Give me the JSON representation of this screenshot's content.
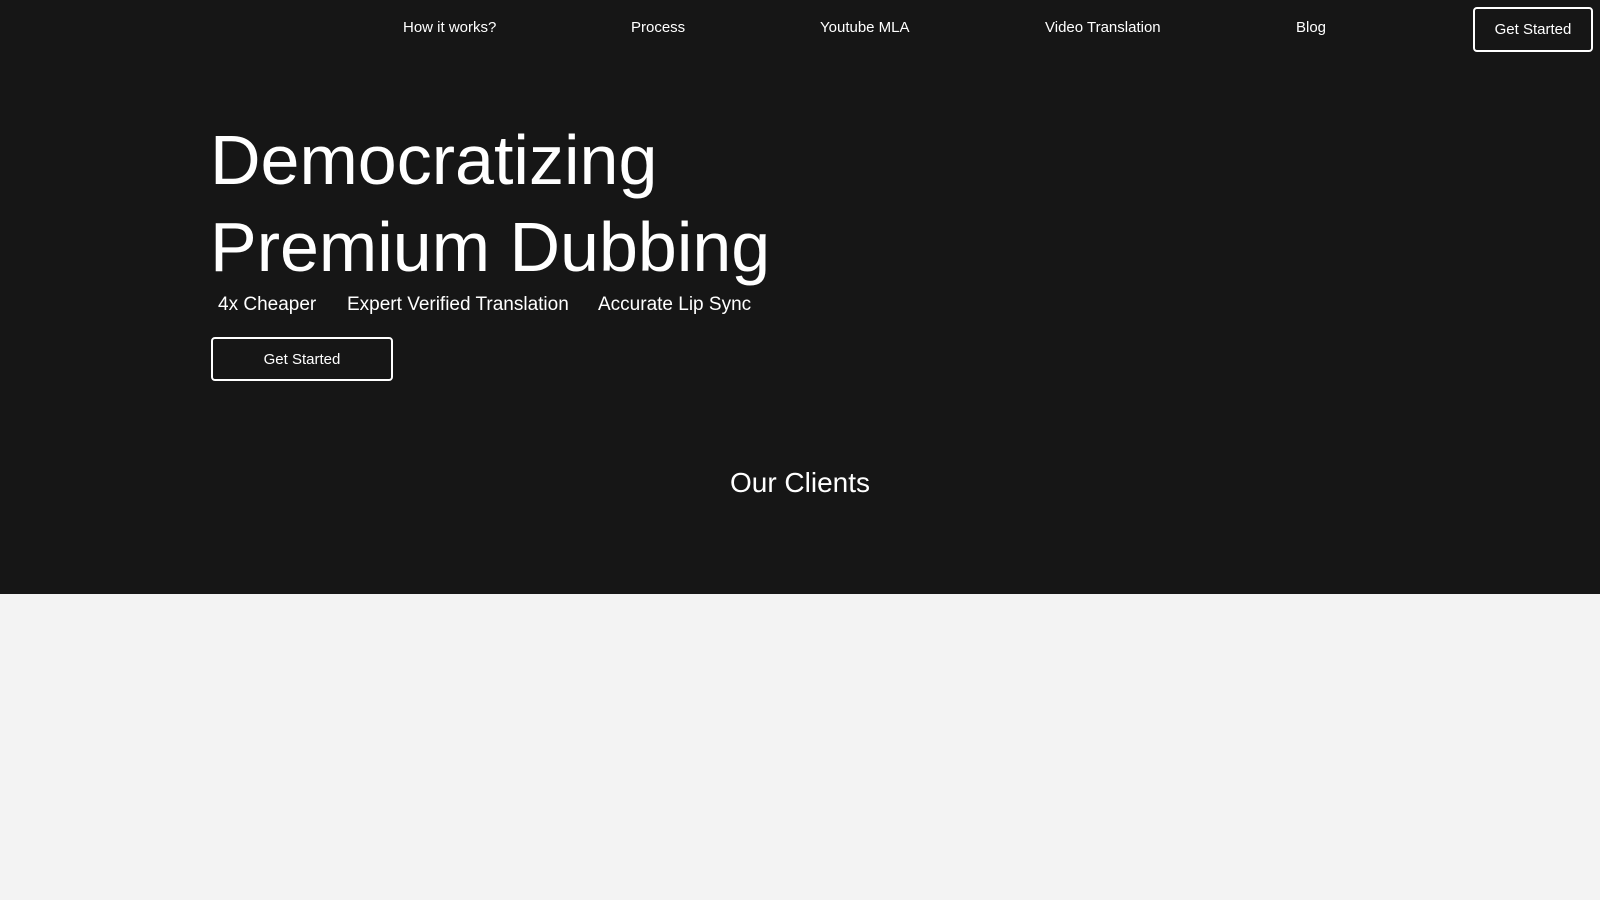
{
  "nav": {
    "links": [
      {
        "label": "How it works?"
      },
      {
        "label": "Process"
      },
      {
        "label": "Youtube MLA"
      },
      {
        "label": "Video Translation"
      },
      {
        "label": "Blog"
      }
    ],
    "cta_label": "Get Started"
  },
  "hero": {
    "headline_line1": "Democratizing",
    "headline_line2": "Premium Dubbing",
    "features": [
      "4x Cheaper",
      "Expert Verified Translation",
      "Accurate Lip Sync"
    ],
    "cta_label": "Get Started"
  },
  "clients": {
    "title": "Our Clients"
  },
  "colors": {
    "hero_background": "#161616",
    "page_background": "#f3f3f3",
    "text": "#ffffff"
  }
}
